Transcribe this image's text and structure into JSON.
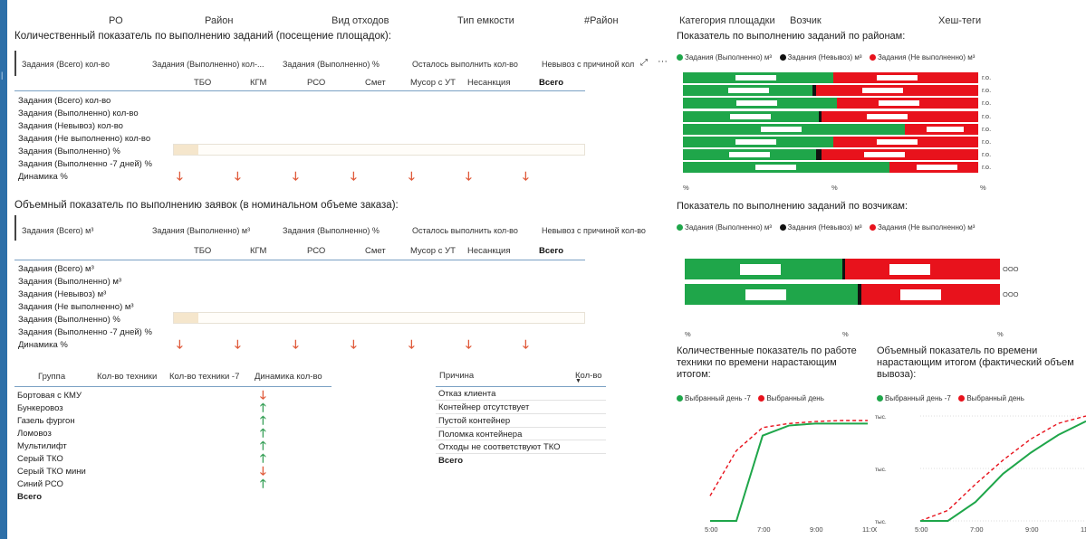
{
  "filters": [
    "РО",
    "Район",
    "Вид отходов",
    "Тип емкости",
    "#Район",
    "Категория площадки",
    "Возчик",
    "Хеш-теги"
  ],
  "sect1": {
    "title": "Количественный показатель по выполнению заданий (посещение площадок):",
    "cards": [
      "Задания (Всего) кол-во",
      "Задания (Выполненно) кол-...",
      "Задания (Выполненно) %",
      "Осталось выполнить кол-во",
      "Невывоз с причиной кол"
    ],
    "cols": [
      "ТБО",
      "КГМ",
      "РСО",
      "Смет",
      "Мусор с УТ",
      "Несанкция",
      "Всего"
    ],
    "rows": [
      "Задания (Всего) кол-во",
      "Задания (Выполненно) кол-во",
      "Задания (Невывоз) кол-во",
      "Задания (Не выполненно) кол-во",
      "Задания (Выполненно) %",
      "Задания (Выполненно -7 дней) %",
      "Динамика %"
    ],
    "progress": 0.06
  },
  "sect2": {
    "title": "Объемный показатель по выполнению заявок (в номинальном объеме заказа):",
    "cards": [
      "Задания (Всего) м³",
      "Задания (Выполненно) м³",
      "Задания (Выполненно) %",
      "Осталось выполнить кол-во",
      "Невывоз с причиной кол-во"
    ],
    "cols": [
      "ТБО",
      "КГМ",
      "РСО",
      "Смет",
      "Мусор с УТ",
      "Несанкция",
      "Всего"
    ],
    "rows": [
      "Задания (Всего) м³",
      "Задания (Выполненно) м³",
      "Задания (Невывоз) м³",
      "Задания (Не выполненно) м³",
      "Задания (Выполненно) %",
      "Задания (Выполненно -7 дней) %",
      "Динамика %"
    ],
    "progress": 0.06
  },
  "groups": {
    "headers": [
      "Группа",
      "Кол-во техники",
      "Кол-во техники -7",
      "Динамика кол-во"
    ],
    "rows": [
      "Бортовая с КМУ",
      "Бункеровоз",
      "Газель фургон",
      "Ломовоз",
      "Мультилифт",
      "Серый ТКО",
      "Серый ТКО мини",
      "Синий РСО"
    ],
    "total": "Всего",
    "dynamics": [
      "down",
      "up",
      "up",
      "up",
      "up",
      "up",
      "down",
      "up"
    ]
  },
  "reasons": {
    "headers": [
      "Причина",
      "Кол-во"
    ],
    "rows": [
      "Отказ клиента",
      "Контейнер отсутствует",
      "Пустой контейнер",
      "Поломка контейнера",
      "Отходы не соответствуют ТКО"
    ],
    "total": "Всего"
  },
  "district_chart": {
    "title": "Показатель по выполнению заданий по районам:",
    "legend": [
      "Задания (Выполненно) м³",
      "Задания (Невывоз) м³",
      "Задания (Не выполненно) м³"
    ],
    "row_label": "г.о.",
    "axis_label": "%"
  },
  "carrier_chart": {
    "title": "Показатель по выполнению заданий по возчикам:",
    "legend": [
      "Задания (Выполненно) м³",
      "Задания (Невывоз) м³",
      "Задания (Не выполненно) м³"
    ],
    "row_label": "ООО",
    "axis_label": "%"
  },
  "line1": {
    "title": [
      "Количественные показатель по работе",
      "техники по времени нарастающим",
      "итогом:"
    ],
    "legend": [
      "Выбранный день -7",
      "Выбранный день"
    ],
    "xticks": [
      "5:00",
      "7:00",
      "9:00",
      "11:00"
    ]
  },
  "line2": {
    "title": [
      "Объемный показатель по времени",
      "нарастающим итогом (фактический объем",
      "вывоза):"
    ],
    "legend": [
      "Выбранный день -7",
      "Выбранный день"
    ],
    "xticks": [
      "5:00",
      "7:00",
      "9:00",
      "11:00"
    ],
    "yticks": [
      "тыс.",
      "тыс.",
      "тыс."
    ]
  },
  "colors": {
    "green": "#1fa64a",
    "black": "#111111",
    "red": "#e8121c",
    "arrow_down": "#e05a3a",
    "arrow_up": "#3aa15a"
  },
  "chart_data": [
    {
      "type": "bar",
      "title": "Показатель по выполнению заданий по районам:",
      "stacked": true,
      "categories": [
        "г.о.",
        "г.о.",
        "г.о.",
        "г.о.",
        "г.о.",
        "г.о.",
        "г.о.",
        "г.о."
      ],
      "series": [
        {
          "name": "Задания (Выполненно) м³",
          "values": [
            0.51,
            0.44,
            0.52,
            0.46,
            0.75,
            0.51,
            0.45,
            0.7
          ]
        },
        {
          "name": "Задания (Невывоз) м³",
          "values": [
            0.0,
            0.01,
            0.0,
            0.01,
            0.0,
            0.0,
            0.02,
            0.0
          ]
        },
        {
          "name": "Задания (Не выполненно) м³",
          "values": [
            0.49,
            0.55,
            0.48,
            0.53,
            0.25,
            0.49,
            0.53,
            0.3
          ]
        }
      ]
    },
    {
      "type": "bar",
      "title": "Показатель по выполнению заданий по возчикам:",
      "stacked": true,
      "categories": [
        "ООО",
        "ООО"
      ],
      "series": [
        {
          "name": "Задания (Выполненно) м³",
          "values": [
            0.5,
            0.55
          ]
        },
        {
          "name": "Задания (Невывоз) м³",
          "values": [
            0.01,
            0.01
          ]
        },
        {
          "name": "Задания (Не выполненно) м³",
          "values": [
            0.49,
            0.44
          ]
        }
      ]
    },
    {
      "type": "line",
      "title": "Количественные показатель по работе техники по времени нарастающим итогом:",
      "x": [
        "5:00",
        "6:00",
        "7:00",
        "8:00",
        "9:00",
        "10:00",
        "11:00"
      ],
      "series": [
        {
          "name": "Выбранный день -7",
          "values": [
            0.25,
            0.7,
            0.93,
            0.97,
            0.99,
            1.0,
            1.0
          ],
          "style": "dashed"
        },
        {
          "name": "Выбранный день",
          "values": [
            0.0,
            0.0,
            0.85,
            0.95,
            0.97,
            0.97,
            0.97
          ]
        }
      ]
    },
    {
      "type": "line",
      "title": "Объемный показатель по времени нарастающим итогом (фактический объем вывоза):",
      "x": [
        "5:00",
        "6:00",
        "7:00",
        "8:00",
        "9:00",
        "10:00",
        "11:00"
      ],
      "series": [
        {
          "name": "Выбранный день -7",
          "values": [
            0.0,
            0.1,
            0.35,
            0.58,
            0.78,
            0.93,
            1.0
          ],
          "style": "dashed"
        },
        {
          "name": "Выбранный день",
          "values": [
            0.0,
            0.0,
            0.18,
            0.45,
            0.65,
            0.82,
            0.95
          ]
        }
      ]
    }
  ]
}
